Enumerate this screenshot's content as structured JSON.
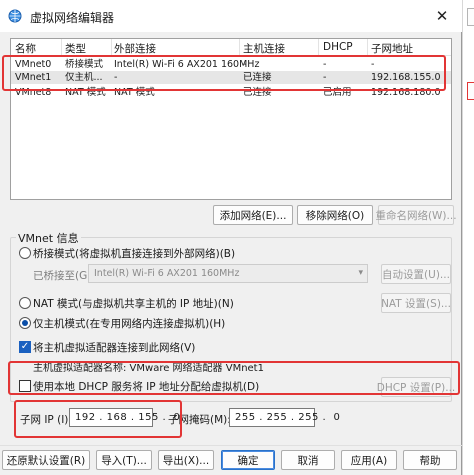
{
  "window": {
    "title": "虚拟网络编辑器",
    "close_glyph": "✕"
  },
  "network_list": {
    "columns": [
      "名称",
      "类型",
      "外部连接",
      "主机连接",
      "DHCP",
      "子网地址"
    ],
    "rows": [
      {
        "name": "VMnet0",
        "type": "桥接模式",
        "external": "Intel(R) Wi-Fi 6 AX201 160MHz",
        "host": "-",
        "dhcp": "-",
        "subnet": "-"
      },
      {
        "name": "VMnet1",
        "type": "仅主机...",
        "external": "-",
        "host": "已连接",
        "dhcp": "-",
        "subnet": "192.168.155.0"
      },
      {
        "name": "VMnet8",
        "type": "NAT 模式",
        "external": "NAT 模式",
        "host": "已连接",
        "dhcp": "已启用",
        "subnet": "192.168.180.0"
      }
    ]
  },
  "list_buttons": {
    "add": "添加网络(E)...",
    "remove": "移除网络(O)",
    "rename": "重命名网络(W)..."
  },
  "vmnet_info": {
    "group_label": "VMnet 信息",
    "bridge_option": "桥接模式(将虚拟机直接连接到外部网络)(B)",
    "bridged_to_label": "已桥接至(G):",
    "bridged_to_value": "Intel(R) Wi-Fi 6 AX201 160MHz",
    "auto_settings": "自动设置(U)...",
    "nat_option": "NAT 模式(与虚拟机共享主机的 IP 地址)(N)",
    "nat_settings": "NAT 设置(S)...",
    "hostonly_option": "仅主机模式(在专用网络内连接虚拟机)(H)",
    "connect_adapter": "将主机虚拟适配器连接到此网络(V)",
    "adapter_name": "主机虚拟适配器名称: VMware 网络适配器 VMnet1",
    "use_dhcp": "使用本地 DHCP 服务将 IP 地址分配给虚拟机(D)",
    "dhcp_settings": "DHCP 设置(P)...",
    "selected_mode": "host-only",
    "connect_adapter_checked": true,
    "use_dhcp_checked": false
  },
  "subnet": {
    "ip_label": "子网 IP (I):",
    "ip_value": "192 . 168 . 155 .  0",
    "mask_label": "子网掩码(M):",
    "mask_value": "255 . 255 . 255 .  0"
  },
  "footer_buttons": {
    "restore": "还原默认设置(R)",
    "import": "导入(T)...",
    "export": "导出(X)...",
    "ok": "确定",
    "cancel": "取消",
    "apply": "应用(A)",
    "help": "帮助"
  },
  "colors": {
    "annotation_red": "#e23535",
    "selected_row": "#e6e6e6",
    "radio_dot": "#0a4ea8",
    "checkbox_fill": "#1a60c0"
  }
}
